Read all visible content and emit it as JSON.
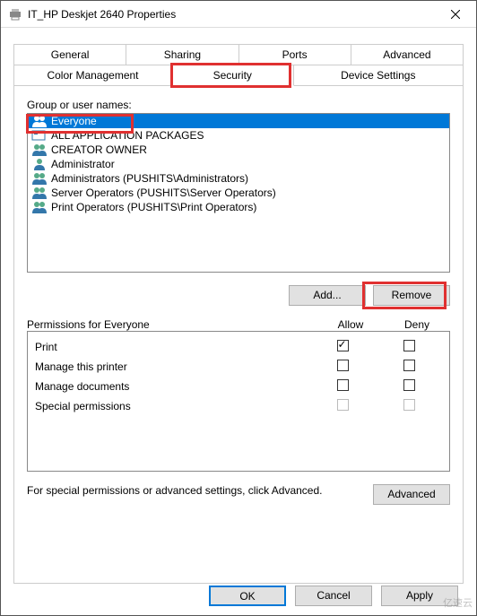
{
  "window": {
    "title": "IT_HP Deskjet 2640 Properties"
  },
  "tabs": {
    "row1": [
      "General",
      "Sharing",
      "Ports",
      "Advanced"
    ],
    "row2": [
      "Color Management",
      "Security",
      "Device Settings"
    ],
    "active": "Security"
  },
  "groupLabel": "Group or user names:",
  "principals": [
    {
      "name": "Everyone",
      "iconType": "group",
      "selected": true
    },
    {
      "name": "ALL APPLICATION PACKAGES",
      "iconType": "package",
      "selected": false
    },
    {
      "name": "CREATOR OWNER",
      "iconType": "group",
      "selected": false
    },
    {
      "name": "Administrator",
      "iconType": "user",
      "selected": false
    },
    {
      "name": "Administrators (PUSHITS\\Administrators)",
      "iconType": "group",
      "selected": false
    },
    {
      "name": "Server Operators (PUSHITS\\Server Operators)",
      "iconType": "group",
      "selected": false
    },
    {
      "name": "Print Operators (PUSHITS\\Print Operators)",
      "iconType": "group",
      "selected": false
    }
  ],
  "buttons": {
    "add": "Add...",
    "remove": "Remove",
    "advanced": "Advanced",
    "ok": "OK",
    "cancel": "Cancel",
    "apply": "Apply"
  },
  "permHeader": {
    "label": "Permissions for Everyone",
    "allow": "Allow",
    "deny": "Deny"
  },
  "permissions": [
    {
      "name": "Print",
      "allow": true,
      "deny": false,
      "disabled": false
    },
    {
      "name": "Manage this printer",
      "allow": false,
      "deny": false,
      "disabled": false
    },
    {
      "name": "Manage documents",
      "allow": false,
      "deny": false,
      "disabled": false
    },
    {
      "name": "Special permissions",
      "allow": false,
      "deny": false,
      "disabled": true
    }
  ],
  "advancedText": "For special permissions or advanced settings, click Advanced.",
  "watermark": "亿速云"
}
